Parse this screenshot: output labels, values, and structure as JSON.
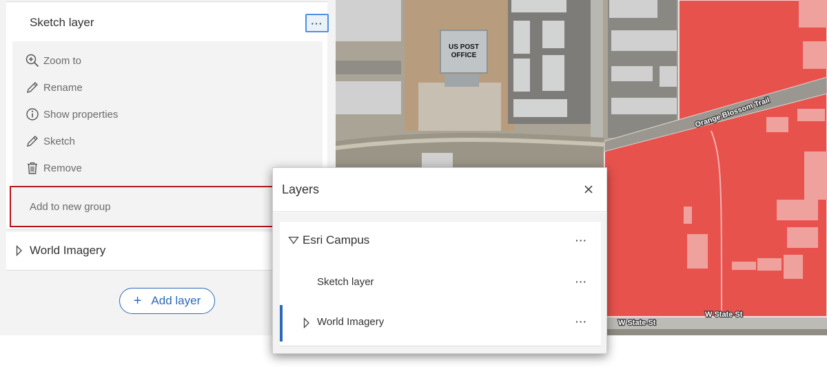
{
  "left_panel": {
    "sketch_layer": {
      "title": "Sketch layer",
      "more_label": "···",
      "actions": [
        {
          "label": "Zoom to",
          "icon": "zoom-in-icon"
        },
        {
          "label": "Rename",
          "icon": "pencil-icon"
        },
        {
          "label": "Show properties",
          "icon": "info-icon"
        },
        {
          "label": "Sketch",
          "icon": "pencil-icon"
        },
        {
          "label": "Remove",
          "icon": "trash-icon"
        }
      ],
      "add_to_group_label": "Add to new group"
    },
    "world_imagery": {
      "title": "World Imagery"
    },
    "add_layer": {
      "plus": "+",
      "label": "Add layer"
    }
  },
  "map": {
    "labels": {
      "post_office_line1": "US POST",
      "post_office_line2": "OFFICE",
      "orange_blossom": "Orange Blossom Trail",
      "w_state_st_1": "W State St",
      "w_state_st_2": "W State St"
    },
    "colors": {
      "sketch_fill": "#e8524d"
    }
  },
  "layers_popup": {
    "title": "Layers",
    "close_icon": "close-icon",
    "items": [
      {
        "label": "Esri Campus",
        "more": "···"
      },
      {
        "label": "Sketch layer",
        "more": "···"
      },
      {
        "label": "World Imagery",
        "more": "···"
      }
    ]
  },
  "colors": {
    "accent": "#2b6ab9",
    "highlight_border": "#b5121b"
  }
}
